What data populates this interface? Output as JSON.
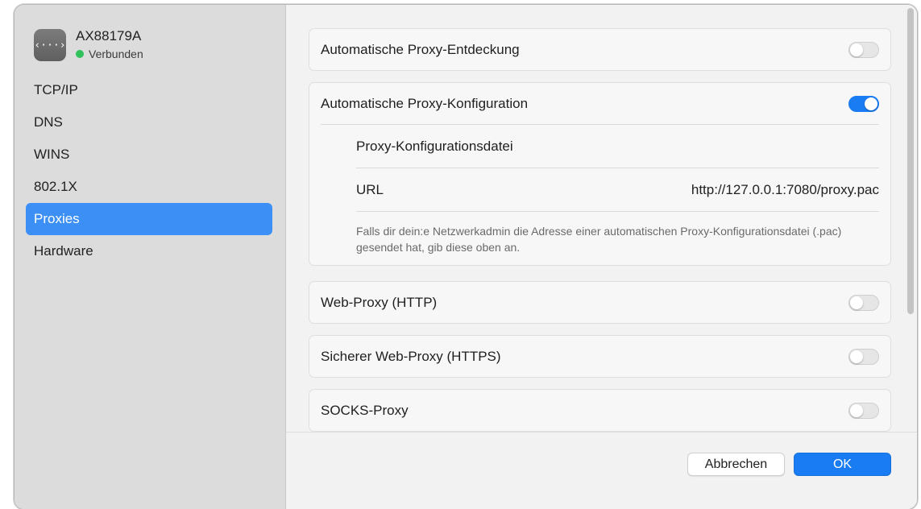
{
  "sidebar": {
    "device": {
      "icon_glyph": "‹···›",
      "icon": "network-adapter-icon",
      "name": "AX88179A",
      "status": "Verbunden",
      "status_color": "#2fc25b"
    },
    "items": [
      {
        "label": "TCP/IP",
        "active": false
      },
      {
        "label": "DNS",
        "active": false
      },
      {
        "label": "WINS",
        "active": false
      },
      {
        "label": "802.1X",
        "active": false
      },
      {
        "label": "Proxies",
        "active": true
      },
      {
        "label": "Hardware",
        "active": false
      }
    ]
  },
  "proxies": {
    "auto_discovery": {
      "label": "Automatische Proxy-Entdeckung",
      "enabled": false
    },
    "auto_config": {
      "label": "Automatische Proxy-Konfiguration",
      "enabled": true,
      "file_label": "Proxy-Konfigurationsdatei",
      "url_label": "URL",
      "url_value": "http://127.0.0.1:7080/proxy.pac",
      "hint": "Falls dir dein:e Netzwerkadmin die Adresse einer automatischen Proxy-Konfigurationsdatei (.pac) gesendet hat, gib diese oben an."
    },
    "web_proxy": {
      "label": "Web-Proxy (HTTP)",
      "enabled": false
    },
    "secure_web_proxy": {
      "label": "Sicherer Web-Proxy (HTTPS)",
      "enabled": false
    },
    "socks_proxy": {
      "label": "SOCKS-Proxy",
      "enabled": false
    }
  },
  "footer": {
    "cancel_label": "Abbrechen",
    "ok_label": "OK"
  },
  "colors": {
    "accent": "#1a7cf2",
    "sidebar_selection": "#3b8ff5"
  }
}
